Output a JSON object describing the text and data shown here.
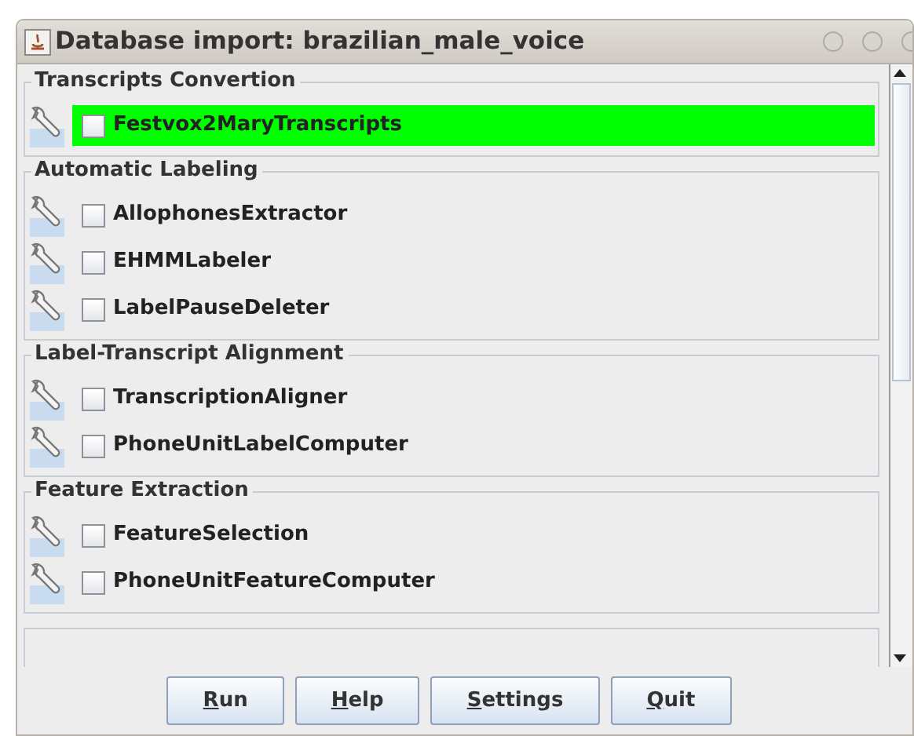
{
  "window": {
    "title": "Database import: brazilian_male_voice"
  },
  "groups": [
    {
      "title": "Transcripts Convertion",
      "items": [
        {
          "label": "Festvox2MaryTranscripts",
          "checked": false,
          "highlighted": true
        }
      ]
    },
    {
      "title": "Automatic Labeling",
      "items": [
        {
          "label": "AllophonesExtractor",
          "checked": false,
          "highlighted": false
        },
        {
          "label": "EHMMLabeler",
          "checked": false,
          "highlighted": false
        },
        {
          "label": "LabelPauseDeleter",
          "checked": false,
          "highlighted": false
        }
      ]
    },
    {
      "title": "Label-Transcript Alignment",
      "items": [
        {
          "label": "TranscriptionAligner",
          "checked": false,
          "highlighted": false
        },
        {
          "label": "PhoneUnitLabelComputer",
          "checked": false,
          "highlighted": false
        }
      ]
    },
    {
      "title": "Feature Extraction",
      "items": [
        {
          "label": "FeatureSelection",
          "checked": false,
          "highlighted": false
        },
        {
          "label": "PhoneUnitFeatureComputer",
          "checked": false,
          "highlighted": false
        }
      ]
    }
  ],
  "buttons": [
    {
      "label": "Run"
    },
    {
      "label": "Help"
    },
    {
      "label": "Settings"
    },
    {
      "label": "Quit"
    }
  ]
}
